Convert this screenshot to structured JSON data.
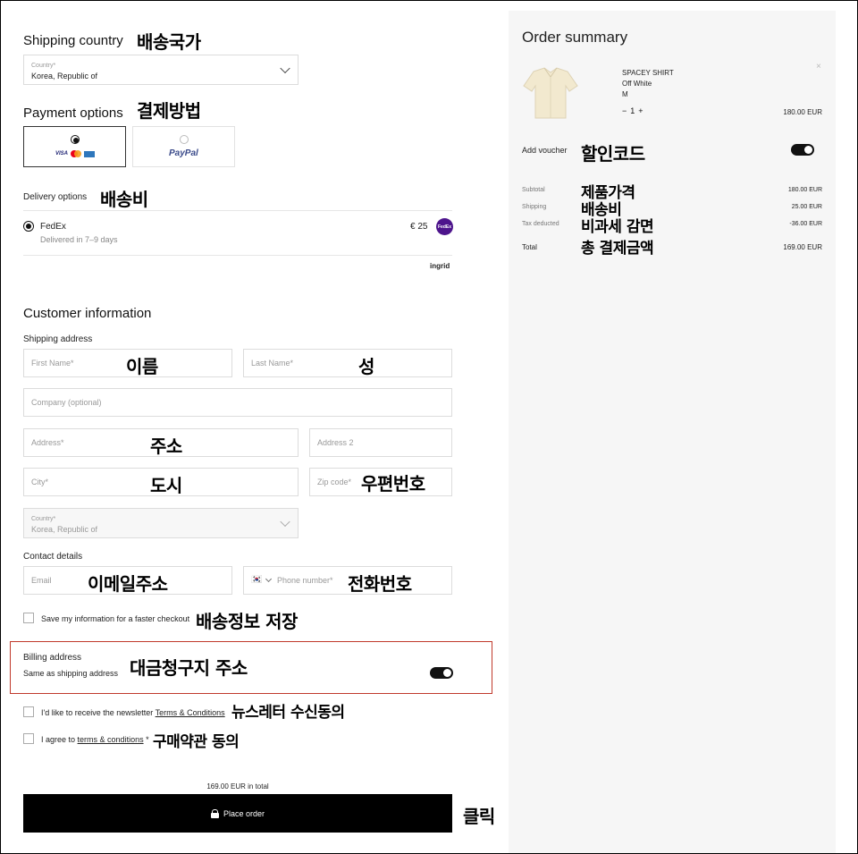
{
  "shipping_country": {
    "title": "Shipping country",
    "annotation": "배송국가",
    "field_label": "Country*",
    "value": "Korea, Republic of"
  },
  "payment": {
    "title": "Payment options",
    "annotation": "결제방법",
    "card_brands": [
      "VISA",
      "mastercard",
      "amex"
    ],
    "paypal_label": "PayPal"
  },
  "delivery": {
    "title": "Delivery options",
    "annotation": "배송비",
    "carrier": "FedEx",
    "eta": "Delivered in 7–9 days",
    "price": "€ 25",
    "carrier_badge": "FedEx",
    "provider": "ingrid"
  },
  "customer": {
    "title": "Customer information",
    "shipping_address_label": "Shipping address",
    "first_name_ph": "First Name*",
    "first_name_note": "이름",
    "last_name_ph": "Last Name*",
    "last_name_note": "성",
    "company_ph": "Company (optional)",
    "address_ph": "Address*",
    "address_note": "주소",
    "address2_ph": "Address 2",
    "city_ph": "City*",
    "city_note": "도시",
    "zip_ph": "Zip code*",
    "zip_note": "우편번호",
    "country_label": "Country*",
    "country_value": "Korea, Republic of",
    "contact_label": "Contact details",
    "email_ph": "Email",
    "email_note": "이메일주소",
    "phone_ph": "Phone number*",
    "phone_note": "전화번호",
    "flag": "🇰🇷",
    "save_info": "Save my information for a faster checkout",
    "save_info_note": "배송정보 저장"
  },
  "billing": {
    "title": "Billing address",
    "subtitle": "Same as shipping address",
    "annotation": "대금청구지 주소"
  },
  "consent": {
    "newsletter_text": "I'd like to receive the newsletter",
    "newsletter_link": "Terms & Conditions",
    "newsletter_note": "뉴스레터 수신동의",
    "terms_prefix": "I agree to",
    "terms_link": "terms & conditions",
    "terms_suffix": "*",
    "terms_note": "구매약관 동의"
  },
  "order": {
    "total_line": "169.00 EUR in total",
    "button_label": "Place order",
    "button_note": "클릭"
  },
  "summary": {
    "title": "Order summary",
    "item": {
      "name": "SPACEY SHIRT",
      "color": "Off White",
      "size": "M",
      "qty": "1",
      "price": "180.00 EUR"
    },
    "voucher_label": "Add voucher",
    "voucher_note": "할인코드",
    "rows": [
      {
        "label": "Subtotal",
        "note": "제품가격",
        "value": "180.00 EUR"
      },
      {
        "label": "Shipping",
        "note": "배송비",
        "value": "25.00 EUR"
      },
      {
        "label": "Tax deducted",
        "note": "비과세 감면",
        "value": "-36.00 EUR"
      }
    ],
    "total": {
      "label": "Total",
      "note": "총 결제금액",
      "value": "169.00 EUR"
    }
  }
}
